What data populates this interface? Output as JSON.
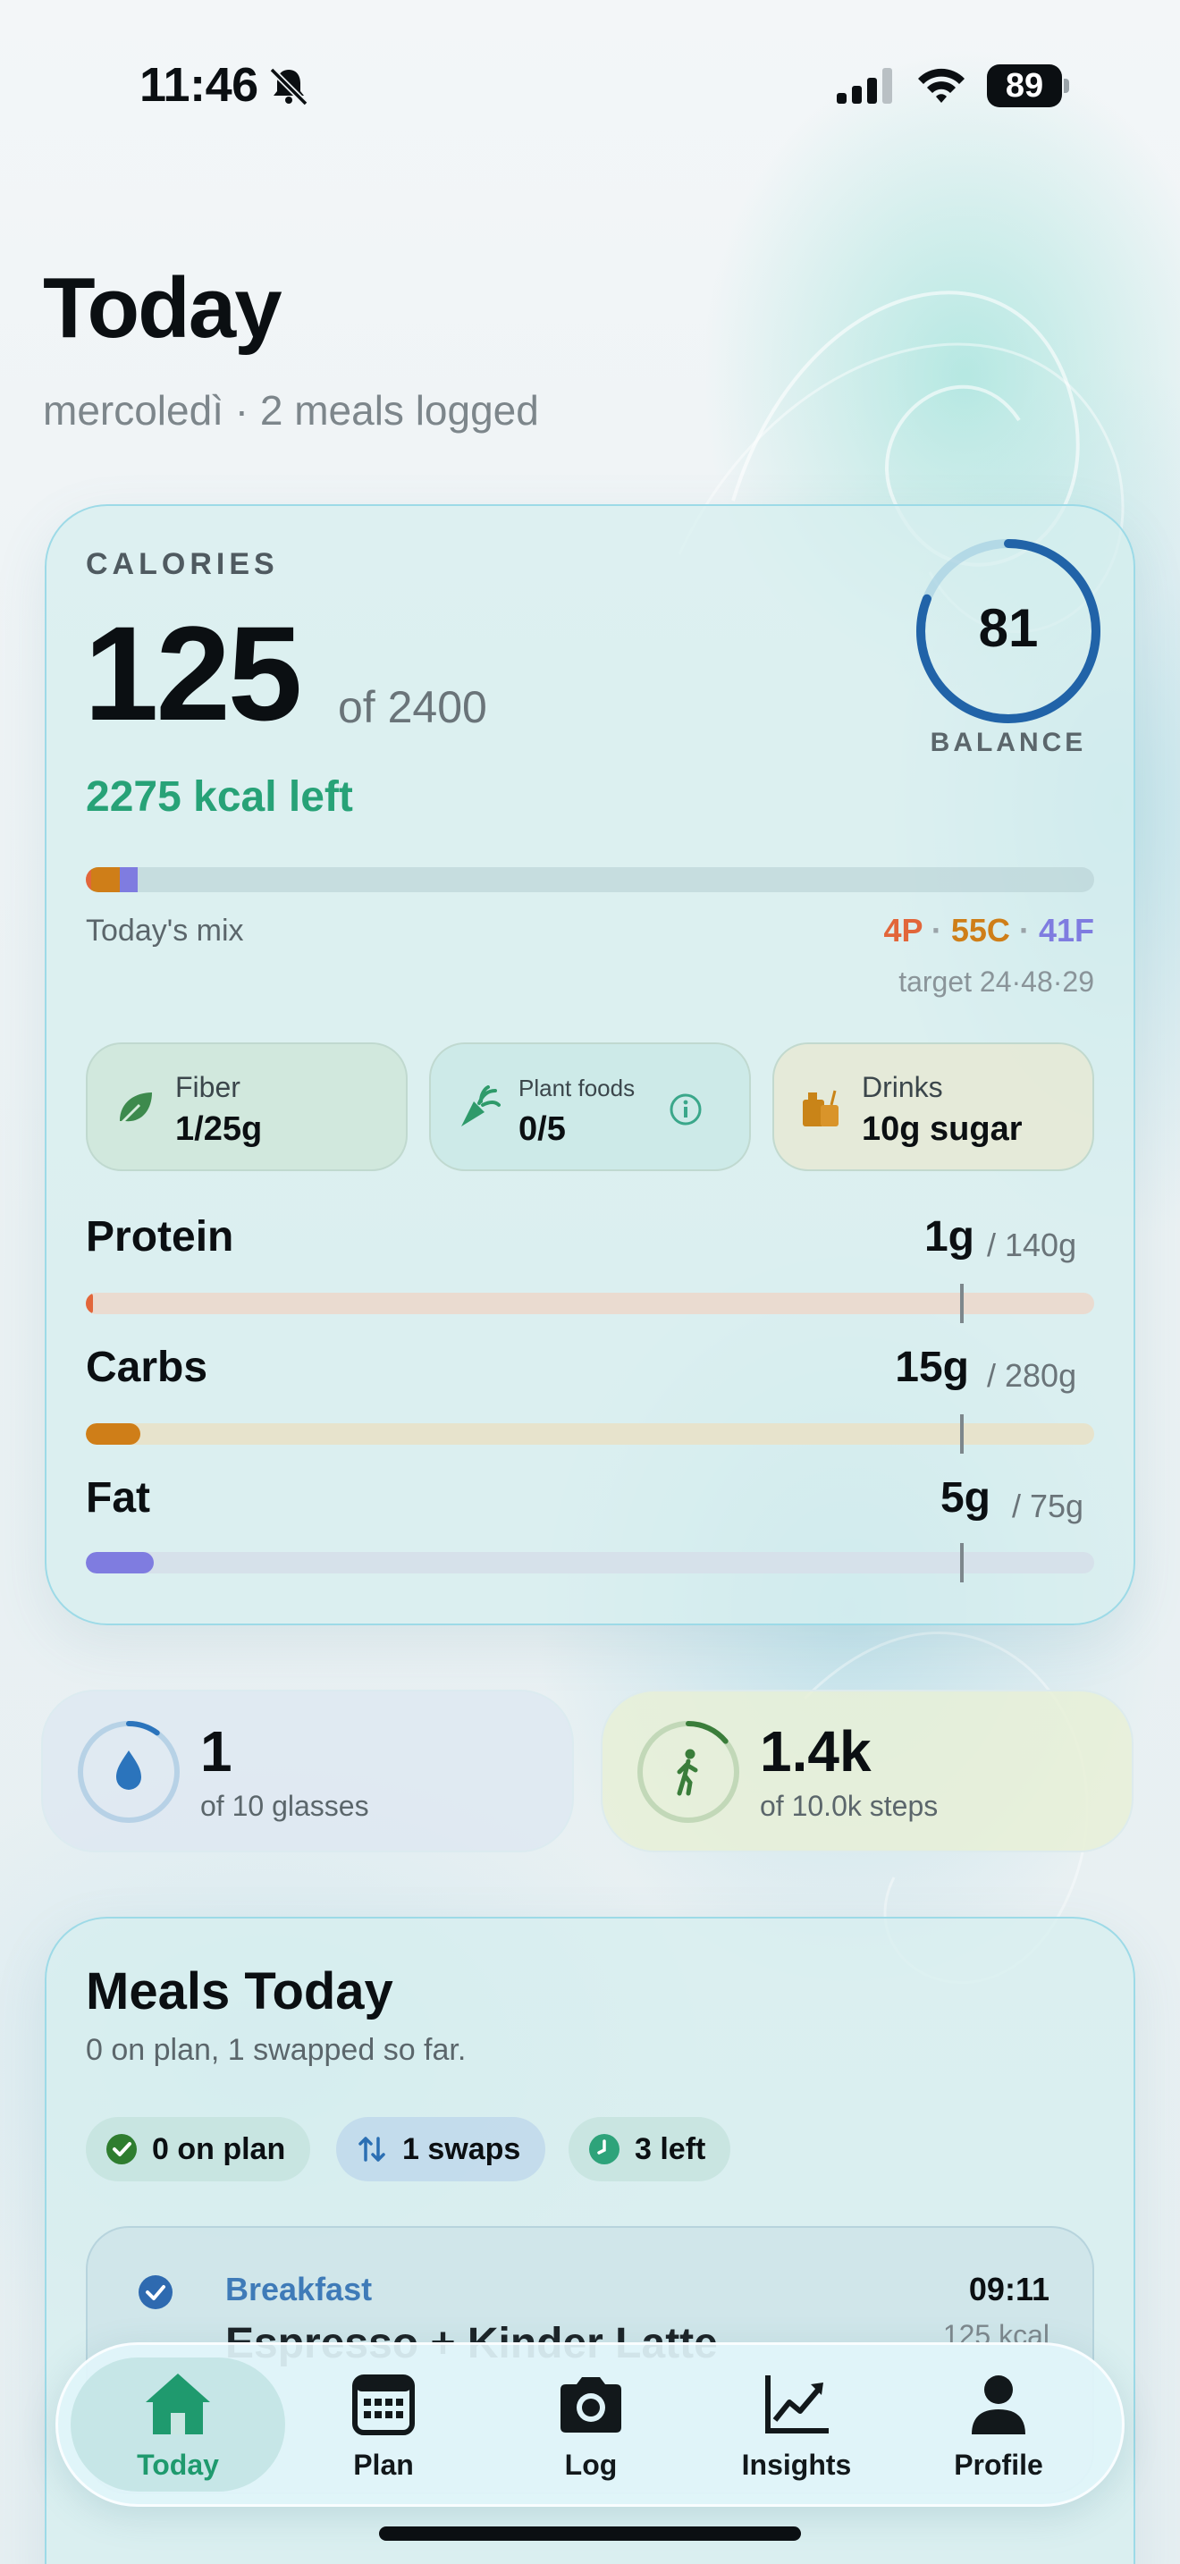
{
  "status_bar": {
    "time": "11:46",
    "battery": "89"
  },
  "header": {
    "title": "Today",
    "subtitle": "mercoledì · 2 meals logged"
  },
  "calories": {
    "label": "CALORIES",
    "consumed": "125",
    "of_target": "of 2400",
    "left": "2275 kcal left",
    "balance_score": "81",
    "balance_label": "BALANCE",
    "balance_fraction": 0.81,
    "mix_label": "Today's mix",
    "mix_protein": "4P",
    "mix_carbs": "55C",
    "mix_fat": "41F",
    "mix_sep": "·",
    "mix_target": "target 24·48·29",
    "mix_fractions": {
      "protein": 0.0025,
      "carbs": 0.028,
      "fat": 0.018
    }
  },
  "pills": {
    "fiber": {
      "title": "Fiber",
      "value": "1/25g",
      "icon": "leaf-icon"
    },
    "plant": {
      "title": "Plant foods",
      "value": "0/5",
      "icon": "carrot-icon"
    },
    "drinks": {
      "title": "Drinks",
      "value": "10g sugar",
      "icon": "drinks-icon"
    }
  },
  "macros": [
    {
      "name": "Protein",
      "value": "1g",
      "target": "/ 140g",
      "fraction": 0.007,
      "color": "#e2663a",
      "track": "#eadbd0"
    },
    {
      "name": "Carbs",
      "value": "15g",
      "target": "/ 280g",
      "fraction": 0.054,
      "color": "#cf7e18",
      "track": "#e7e3cc"
    },
    {
      "name": "Fat",
      "value": "5g",
      "target": "/ 75g",
      "fraction": 0.067,
      "color": "#7f7ce0",
      "track": "#d6e1ea"
    }
  ],
  "water": {
    "value": "1",
    "sub": "of 10 glasses",
    "fraction": 0.1,
    "icon": "water-drop-icon"
  },
  "steps": {
    "value": "1.4k",
    "sub": "of 10.0k steps",
    "fraction": 0.14,
    "icon": "walking-icon"
  },
  "meals": {
    "title": "Meals Today",
    "subtitle": "0 on plan, 1 swapped so far.",
    "chips": {
      "on_plan": "0 on plan",
      "swaps": "1 swaps",
      "left": "3 left"
    },
    "items": [
      {
        "type": "Breakfast",
        "time": "09:11",
        "name": "Espresso + Kinder Latte",
        "kcal": "125 kcal"
      }
    ]
  },
  "tabbar": {
    "tabs": [
      {
        "label": "Today",
        "icon": "home-icon",
        "active": true
      },
      {
        "label": "Plan",
        "icon": "calendar-icon",
        "active": false
      },
      {
        "label": "Log",
        "icon": "camera-icon",
        "active": false
      },
      {
        "label": "Insights",
        "icon": "chart-icon",
        "active": false
      },
      {
        "label": "Profile",
        "icon": "person-icon",
        "active": false
      }
    ]
  },
  "colors": {
    "accent_green": "#27a277",
    "balance_ring": "#2163a8",
    "protein": "#e2663a",
    "carbs": "#cf7e18",
    "fat": "#7f7ce0"
  }
}
